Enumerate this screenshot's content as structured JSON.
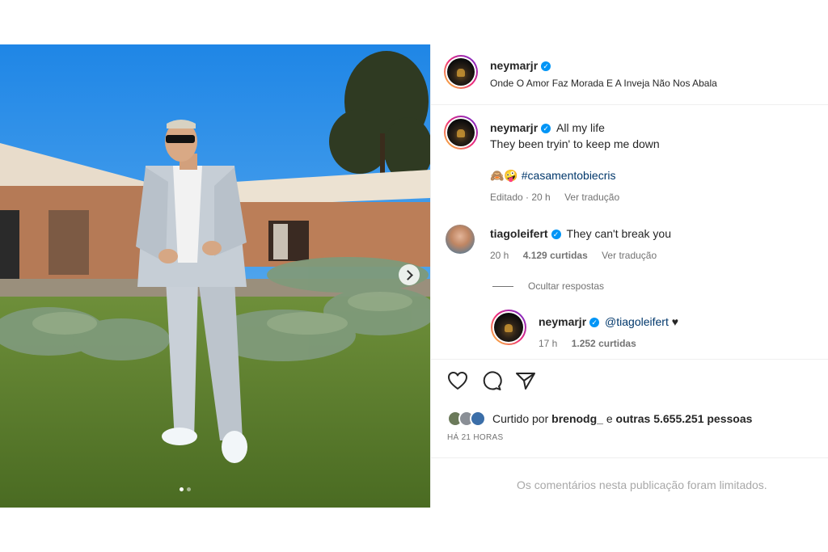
{
  "header": {
    "username": "neymarjr",
    "subtitle": "Onde O Amor Faz Morada E A Inveja Não Nos Abala"
  },
  "caption": {
    "username": "neymarjr",
    "line1": "All my life",
    "line2": "They been tryin' to keep me down",
    "emojis": "🙈🤪",
    "hashtag": "#casamentobiecris",
    "edited": "Editado",
    "age": "20 h",
    "translate": "Ver tradução"
  },
  "comment": {
    "username": "tiagoleifert",
    "text": "They can't break you",
    "age": "20 h",
    "likes": "4.129 curtidas",
    "translate": "Ver tradução"
  },
  "hide_replies": "Ocultar respostas",
  "reply": {
    "username": "neymarjr",
    "mention": "@tiagoleifert",
    "heart": "♥",
    "age": "17 h",
    "likes": "1.252 curtidas"
  },
  "actions": {
    "like_icon": "heart-icon",
    "comment_icon": "comment-icon",
    "share_icon": "share-icon"
  },
  "likes_summary": {
    "prefix": "Curtido por",
    "user": "brenodg_",
    "middle": "e",
    "others": "outras 5.655.251 pessoas"
  },
  "timestamp": "HÁ 21 HORAS",
  "comments_limited": "Os comentários nesta publicação foram limitados.",
  "colors": {
    "verified": "#0095f6",
    "link": "#00376b",
    "muted": "#737373",
    "sky": "#2f8ee8"
  }
}
